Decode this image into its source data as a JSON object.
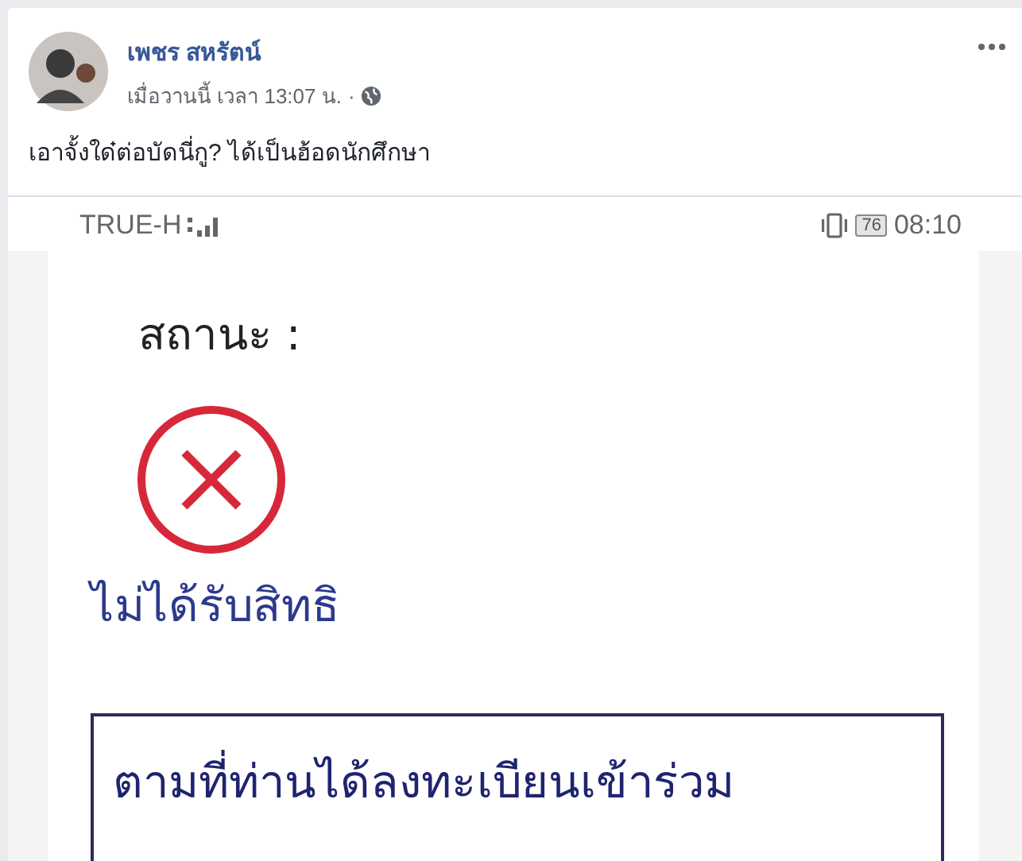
{
  "post": {
    "author": "เพชร สหรัตน์",
    "timestamp": "เมื่อวานนี้ เวลา 13:07 น.",
    "separator": "·",
    "text": "เอาจั้งใด๋ต่อบัดนี่กู? ได้เป็นฮ้อดนักศึกษา"
  },
  "attachment": {
    "status_bar": {
      "carrier": "TRUE-H",
      "battery": "76",
      "time": "08:10"
    },
    "status_label": "สถานะ :",
    "result": "ไม่ได้รับสิทธิ",
    "notice": "ตามที่ท่านได้ลงทะเบียนเข้าร่วม"
  }
}
